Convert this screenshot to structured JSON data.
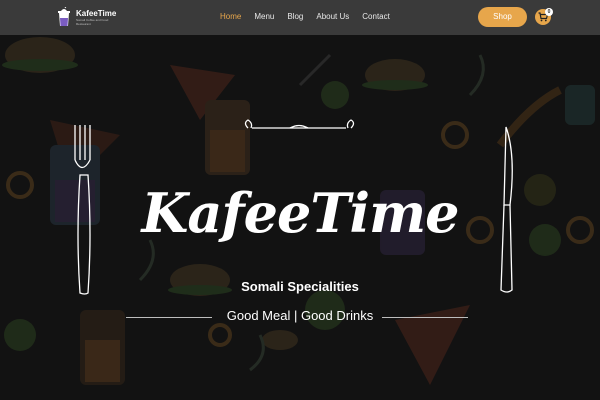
{
  "brand": {
    "name": "KafeeTime",
    "tagline": "Somali Coffee and Food Restaurant"
  },
  "nav": {
    "items": [
      {
        "label": "Home"
      },
      {
        "label": "Menu"
      },
      {
        "label": "Blog"
      },
      {
        "label": "About Us"
      },
      {
        "label": "Contact"
      }
    ],
    "active": "Home"
  },
  "header": {
    "shop_label": "Shop",
    "cart_count": "0"
  },
  "hero": {
    "title": "KafeeTime",
    "subtitle": "Somali Specialities",
    "tagline": "Good Meal | Good Drinks"
  },
  "colors": {
    "accent": "#e7a64b",
    "header_bg": "#3a3a3a",
    "hero_bg": "#121212"
  },
  "icons": [
    "cup-logo-icon",
    "cart-icon",
    "fork-icon",
    "knife-icon",
    "ornament-icon"
  ]
}
